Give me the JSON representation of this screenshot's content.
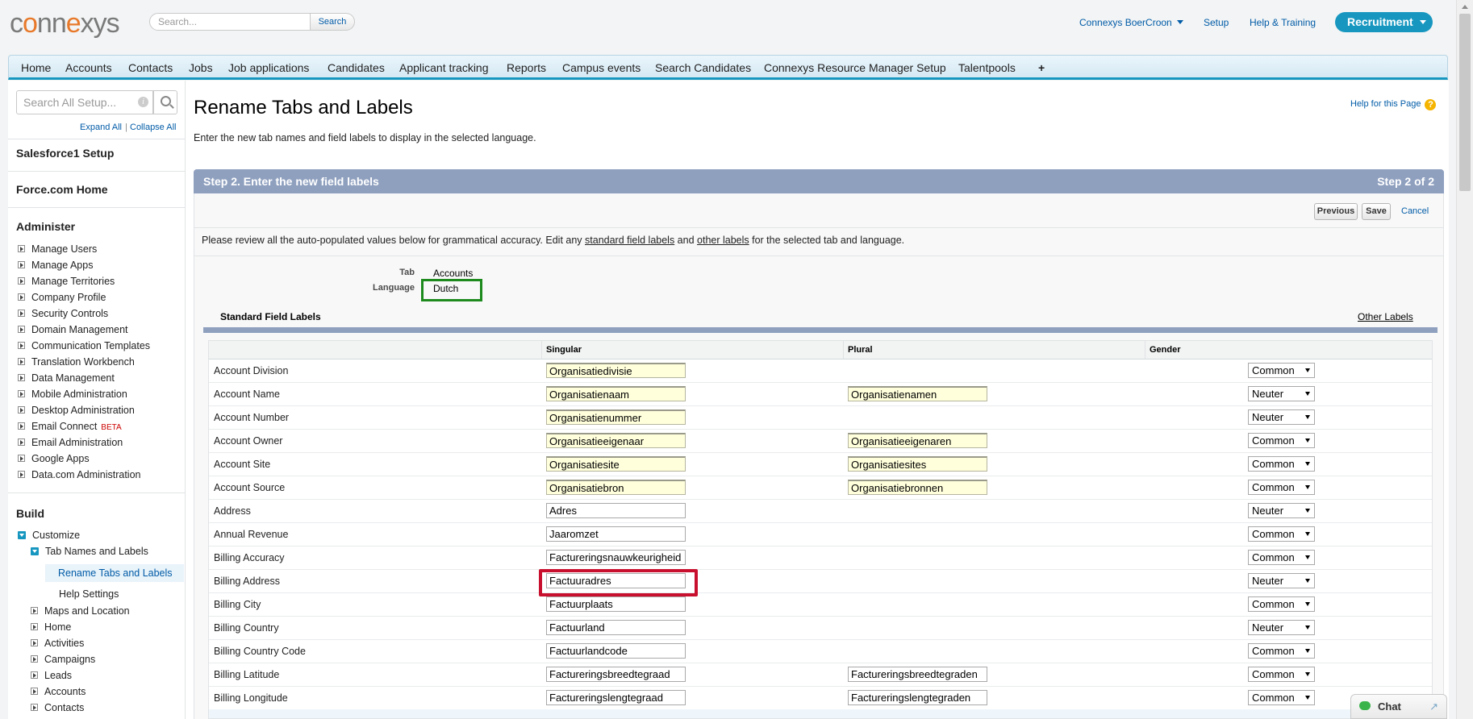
{
  "header": {
    "logo": {
      "c": "c",
      "o1": "o",
      "nn": "nn",
      "e": "e",
      "x": "x",
      "y": "y",
      "s": "s"
    },
    "search_placeholder": "Search...",
    "search_button": "Search",
    "org_menu": "Connexys BoerCroon",
    "setup_link": "Setup",
    "help_link": "Help & Training",
    "app_button": "Recruitment"
  },
  "tabs": [
    "Home",
    "Accounts",
    "Contacts",
    "Jobs",
    "Job applications",
    "Candidates",
    "Applicant tracking",
    "Reports",
    "Campus events",
    "Search Candidates",
    "Connexys Resource Manager Setup",
    "Talentpools",
    "+"
  ],
  "sidebar": {
    "search_placeholder": "Search All Setup...",
    "expand_all": "Expand All",
    "sep": "|",
    "collapse_all": "Collapse All",
    "salesforce1": "Salesforce1 Setup",
    "force_home": "Force.com Home",
    "administer": "Administer",
    "admin_items": [
      "Manage Users",
      "Manage Apps",
      "Manage Territories",
      "Company Profile",
      "Security Controls",
      "Domain Management",
      "Communication Templates",
      "Translation Workbench",
      "Data Management",
      "Mobile Administration",
      "Desktop Administration",
      "Email Connect",
      "Email Administration",
      "Google Apps",
      "Data.com Administration"
    ],
    "beta": "BETA",
    "build": "Build",
    "customize": "Customize",
    "tab_names_labels": "Tab Names and Labels",
    "rename_tabs": "Rename Tabs and Labels",
    "help_settings": "Help Settings",
    "build_items": [
      "Maps and Location",
      "Home",
      "Activities",
      "Campaigns",
      "Leads",
      "Accounts",
      "Contacts"
    ]
  },
  "main": {
    "title": "Rename Tabs and Labels",
    "description": "Enter the new tab names and field labels to display in the selected language.",
    "help_page": "Help for this Page",
    "help_q": "?",
    "step_title": "Step 2. Enter the new field labels",
    "step_count": "Step 2 of 2",
    "previous": "Previous",
    "save": "Save",
    "cancel": "Cancel",
    "review": {
      "part1": "Please review all the auto-populated values below for grammatical accuracy. Edit any ",
      "link1": "standard field labels",
      "part2": " and ",
      "link2": "other labels",
      "part3": " for the selected tab and language."
    },
    "tab_label": "Tab",
    "tab_value": "Accounts",
    "language_label": "Language",
    "language_value": "Dutch",
    "standard_field_labels": "Standard Field Labels",
    "other_labels": "Other Labels",
    "columns": {
      "singular": "Singular",
      "plural": "Plural",
      "gender": "Gender"
    },
    "rows": [
      {
        "field": "Account Division",
        "singular": "Organisatiedivisie",
        "plural": "",
        "gender": "Common"
      },
      {
        "field": "Account Name",
        "singular": "Organisatienaam",
        "plural": "Organisatienamen",
        "gender": "Neuter"
      },
      {
        "field": "Account Number",
        "singular": "Organisatienummer",
        "plural": "",
        "gender": "Neuter"
      },
      {
        "field": "Account Owner",
        "singular": "Organisatieeigenaar",
        "plural": "Organisatieeigenaren",
        "gender": "Common"
      },
      {
        "field": "Account Site",
        "singular": "Organisatiesite",
        "plural": "Organisatiesites",
        "gender": "Common"
      },
      {
        "field": "Account Source",
        "singular": "Organisatiebron",
        "plural": "Organisatiebronnen",
        "gender": "Common"
      },
      {
        "field": "Address",
        "singular": "Adres",
        "plural": "",
        "gender": "Neuter"
      },
      {
        "field": "Annual Revenue",
        "singular": "Jaaromzet",
        "plural": "",
        "gender": "Common"
      },
      {
        "field": "Billing Accuracy",
        "singular": "Factureringsnauwkeurigheid",
        "plural": "",
        "gender": "Common"
      },
      {
        "field": "Billing Address",
        "singular": "Factuuradres",
        "plural": "",
        "gender": "Neuter"
      },
      {
        "field": "Billing City",
        "singular": "Factuurplaats",
        "plural": "",
        "gender": "Common"
      },
      {
        "field": "Billing Country",
        "singular": "Factuurland",
        "plural": "",
        "gender": "Neuter"
      },
      {
        "field": "Billing Country Code",
        "singular": "Factuurlandcode",
        "plural": "",
        "gender": "Common"
      },
      {
        "field": "Billing Latitude",
        "singular": "Factureringsbreedtegraad",
        "plural": "Factureringsbreedtegraden",
        "gender": "Common"
      },
      {
        "field": "Billing Longitude",
        "singular": "Factureringslengtegraad",
        "plural": "Factureringslengtegraden",
        "gender": "Common"
      }
    ]
  },
  "chat": {
    "label": "Chat",
    "popout": "↗"
  }
}
